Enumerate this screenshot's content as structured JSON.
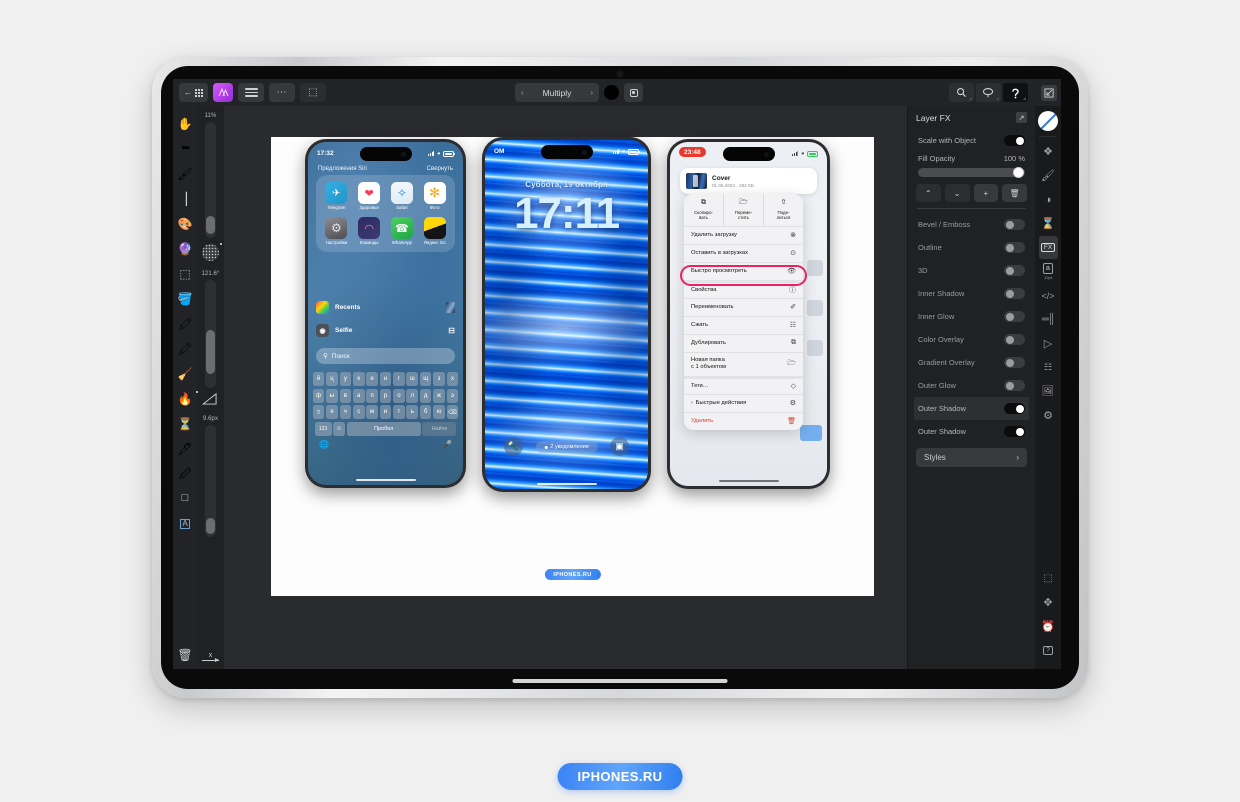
{
  "app": {
    "toolbar": {
      "back_icon": "back-gallery-icon",
      "logo_icon": "app-logo-icon",
      "menu_icon": "hamburger-menu-icon",
      "more_icon": "ellipsis-icon",
      "select_icon": "marquee-select-icon",
      "blend_mode": "Multiply",
      "prev_label": "‹",
      "next_label": "›",
      "color_swatch": "#000000",
      "mask_icon": "layer-mask-icon",
      "right_tools": [
        {
          "name": "zoom-tool",
          "glyph": "⌕"
        },
        {
          "name": "lasso-tool",
          "glyph": "◌"
        },
        {
          "name": "undo-tool",
          "glyph": "↶"
        }
      ],
      "expand_icon": "expand-icon"
    },
    "tools": [
      {
        "name": "hand-tool",
        "glyph": "✋"
      },
      {
        "name": "cursor-tool",
        "glyph": "↖"
      },
      {
        "name": "eyedropper-tool",
        "glyph": "🖌"
      },
      {
        "name": "crop-tool",
        "glyph": "⌗"
      },
      {
        "name": "paintbrush-tool",
        "glyph": "🖌"
      },
      {
        "name": "magic-wand-tool",
        "glyph": "✨"
      },
      {
        "name": "marquee-tool",
        "glyph": "⬚"
      },
      {
        "name": "paint-bucket-tool",
        "glyph": "🪣"
      },
      {
        "name": "airbrush-tool",
        "glyph": "✒"
      },
      {
        "name": "pencil-tool",
        "glyph": "✏"
      },
      {
        "name": "eraser-tool",
        "glyph": "🧹"
      },
      {
        "name": "smudge-tool",
        "glyph": "🔥"
      },
      {
        "name": "clone-stamp-tool",
        "glyph": "⌛"
      },
      {
        "name": "blur-tool",
        "glyph": "🖋"
      },
      {
        "name": "pen-tool",
        "glyph": "✑"
      },
      {
        "name": "shape-tool",
        "glyph": "□"
      },
      {
        "name": "text-tool",
        "glyph": "A"
      }
    ],
    "trash_icon": "trash-icon",
    "sliders": [
      {
        "name": "opacity-slider",
        "value": "11%",
        "fill": 0.11
      },
      {
        "name": "angle-slider",
        "value": "121.6°",
        "fill": 0.55
      },
      {
        "name": "size-slider",
        "value": "9.6px",
        "fill": 0.12
      }
    ],
    "slider_icons": {
      "halftone": "halftone-pattern-icon",
      "angle": "angle-triangle-icon",
      "axis": "x-axis-icon",
      "axis_label": "x"
    },
    "fx_panel": {
      "title": "Layer FX",
      "popout_icon": "popout-icon",
      "scale_with_object": {
        "label": "Scale with Object",
        "on": true
      },
      "fill_opacity": {
        "label": "Fill Opacity",
        "value": "100 %",
        "fill": 1.0
      },
      "actions": [
        {
          "name": "move-up-button",
          "glyph": "⌃"
        },
        {
          "name": "move-down-button",
          "glyph": "⌄"
        },
        {
          "name": "add-effect-button",
          "glyph": "+"
        },
        {
          "name": "delete-effect-button",
          "glyph": "🗑"
        }
      ],
      "effects": [
        {
          "label": "Bevel / Emboss",
          "on": false,
          "selected": false
        },
        {
          "label": "Outline",
          "on": false,
          "selected": false
        },
        {
          "label": "3D",
          "on": false,
          "selected": false
        },
        {
          "label": "Inner Shadow",
          "on": false,
          "selected": false
        },
        {
          "label": "Inner Glow",
          "on": false,
          "selected": false
        },
        {
          "label": "Color Overlay",
          "on": false,
          "selected": false
        },
        {
          "label": "Gradient Overlay",
          "on": false,
          "selected": false
        },
        {
          "label": "Outer Glow",
          "on": false,
          "selected": false
        },
        {
          "label": "Outer Shadow",
          "on": true,
          "selected": true
        },
        {
          "label": "Outer Shadow",
          "on": true,
          "selected": false
        }
      ],
      "styles_button": {
        "label": "Styles",
        "chevron": "›"
      }
    },
    "icon_rail": {
      "color_icon": "color-wheel-icon",
      "items": [
        {
          "name": "layers-icon",
          "glyph": "❖",
          "selected": false
        },
        {
          "name": "brush-icon",
          "glyph": "🖌",
          "selected": false
        },
        {
          "name": "adjustments-icon",
          "glyph": "◑",
          "selected": false
        },
        {
          "name": "hourglass-icon",
          "glyph": "⌛",
          "selected": false
        },
        {
          "name": "fx-icon",
          "glyph": "FX",
          "selected": true
        },
        {
          "name": "text-size-icon",
          "glyph": "a",
          "sub": "12pt",
          "selected": false
        },
        {
          "name": "code-icon",
          "glyph": "‹›",
          "selected": false
        },
        {
          "name": "histogram-icon",
          "glyph": "‖‖",
          "selected": false
        },
        {
          "name": "play-icon",
          "glyph": "▷",
          "selected": false
        },
        {
          "name": "list-icon",
          "glyph": "≣",
          "selected": false
        },
        {
          "name": "image-icon",
          "glyph": "Ὓc",
          "selected": false
        },
        {
          "name": "file-settings-icon",
          "glyph": "⚙",
          "selected": false
        }
      ],
      "bottom_items": [
        {
          "name": "transform-icon",
          "glyph": "⬚"
        },
        {
          "name": "move-icon",
          "glyph": "✥"
        },
        {
          "name": "history-icon",
          "glyph": "🕑"
        },
        {
          "name": "help-icon",
          "glyph": "?"
        }
      ]
    }
  },
  "artboard": {
    "badge": "IPHONES.RU",
    "phone1": {
      "status": {
        "time": "17:32",
        "signal": "signal-icon",
        "wifi": "wifi-icon",
        "battery": "battery-icon",
        "battery_level": "64"
      },
      "siri_label": "Предложения Siri",
      "collapse_label": "Свернуть",
      "apps": [
        {
          "label": "Telegram",
          "color": "#ffffff",
          "glyph": "✈",
          "icon_bg": "linear-gradient(135deg,#37aee2,#1e96c8)",
          "glyph_color": "#ffffff"
        },
        {
          "label": "Здоровье",
          "color": "#ffffff",
          "glyph": "♥",
          "icon_bg": "#ffffff",
          "glyph_color": "#fb3b5c"
        },
        {
          "label": "Safari",
          "color": "#ffffff",
          "glyph": "◉",
          "icon_bg": "linear-gradient(160deg,#f4f7fb,#d9e6f5)",
          "glyph_color": "#1b8ff0"
        },
        {
          "label": "Фото",
          "color": "#ffffff",
          "glyph": "✻",
          "icon_bg": "#ffffff",
          "glyph_color": "#f6a623"
        },
        {
          "label": "Настройки",
          "color": "#ffffff",
          "glyph": "⚙",
          "icon_bg": "linear-gradient(160deg,#8e8e93,#5a5a5e)",
          "glyph_color": "#e9e9ea"
        },
        {
          "label": "Команды",
          "color": "#ffffff",
          "glyph": "◰",
          "icon_bg": "linear-gradient(150deg,#2a2a5e,#3a3a72)",
          "glyph_color": "#ff7fc4"
        },
        {
          "label": "WhatsApp",
          "color": "#ffffff",
          "glyph": "✆",
          "icon_bg": "linear-gradient(150deg,#4fd15f,#1fa447)",
          "glyph_color": "#ffffff"
        },
        {
          "label": "Яндекс Go",
          "color": "#ffffff",
          "glyph": "",
          "icon_bg": "linear-gradient(160deg,#ffd60a 50%,#111 50%)",
          "glyph_color": "#111111"
        }
      ],
      "rows": [
        {
          "label": "Recents",
          "icon": "photos-icon",
          "trail": "preview-thumb-icon"
        },
        {
          "label": "Selfie",
          "icon": "camera-icon",
          "trail": "share-icon"
        }
      ],
      "search": {
        "placeholder": "Поиск",
        "icon": "search-icon"
      },
      "keyboard": {
        "row1": [
          "й",
          "ц",
          "у",
          "к",
          "е",
          "н",
          "г",
          "ш",
          "щ",
          "з",
          "х"
        ],
        "row2": [
          "ф",
          "ы",
          "в",
          "а",
          "п",
          "р",
          "о",
          "л",
          "д",
          "ж",
          "э"
        ],
        "row3": [
          "⇧",
          "я",
          "ч",
          "с",
          "м",
          "и",
          "т",
          "ь",
          "б",
          "ю",
          "⌫"
        ],
        "numbers": "123",
        "emoji": "☺",
        "space": "Пробел",
        "go": "Найти",
        "globe": "🌐",
        "mic": "🎤"
      }
    },
    "phone2": {
      "status": {
        "carrier": "OM",
        "signal": "signal-icon",
        "wifi": "wifi-icon",
        "battery": "battery-icon"
      },
      "date": "Суббота, 19 октября",
      "time": "17:11",
      "notification": "2 уведомления",
      "flashlight_icon": "flashlight-icon",
      "camera_icon": "camera-icon"
    },
    "phone3": {
      "status": {
        "time": "23:48",
        "signal": "signal-icon",
        "wifi": "wifi-icon",
        "battery": "battery-icon"
      },
      "file": {
        "name": "Cover",
        "meta": "01.06.2024 · 292 КБ",
        "thumb": "file-thumbnail"
      },
      "quick_actions": [
        {
          "label": "Скопиро-\nвать",
          "icon": "copy-icon",
          "glyph": "⧉"
        },
        {
          "label": "Переме-\nстить",
          "icon": "move-folder-icon",
          "glyph": "🗀"
        },
        {
          "label": "Поде-\nлиться",
          "icon": "share-icon",
          "glyph": "⇧"
        }
      ],
      "menu": [
        {
          "label": "Удалить загрузку",
          "glyph": "⊗",
          "kind": "normal"
        },
        {
          "label": "Оставить в загрузках",
          "glyph": "⊙",
          "kind": "highlighted"
        },
        {
          "label": "Быстро просмотреть",
          "glyph": "👁",
          "kind": "normal"
        },
        {
          "label": "Свойства",
          "glyph": "ⓘ",
          "kind": "group-start"
        },
        {
          "label": "Переименовать",
          "glyph": "✐",
          "kind": "normal"
        },
        {
          "label": "Сжать",
          "glyph": "☷",
          "kind": "normal"
        },
        {
          "label": "Дублировать",
          "glyph": "⧉",
          "kind": "normal"
        },
        {
          "label": "Новая папка\nс 1 объектом",
          "glyph": "🗁",
          "kind": "tall"
        },
        {
          "label": "Теги…",
          "glyph": "◇",
          "kind": "group-start"
        },
        {
          "label": "Быстрые действия",
          "glyph": "⚙",
          "kind": "submenu",
          "chevron": "›"
        },
        {
          "label": "Удалить",
          "glyph": "🗑",
          "kind": "danger"
        }
      ],
      "highlight_color": "#ef2060"
    }
  },
  "page_badge": "IPHONES.RU"
}
